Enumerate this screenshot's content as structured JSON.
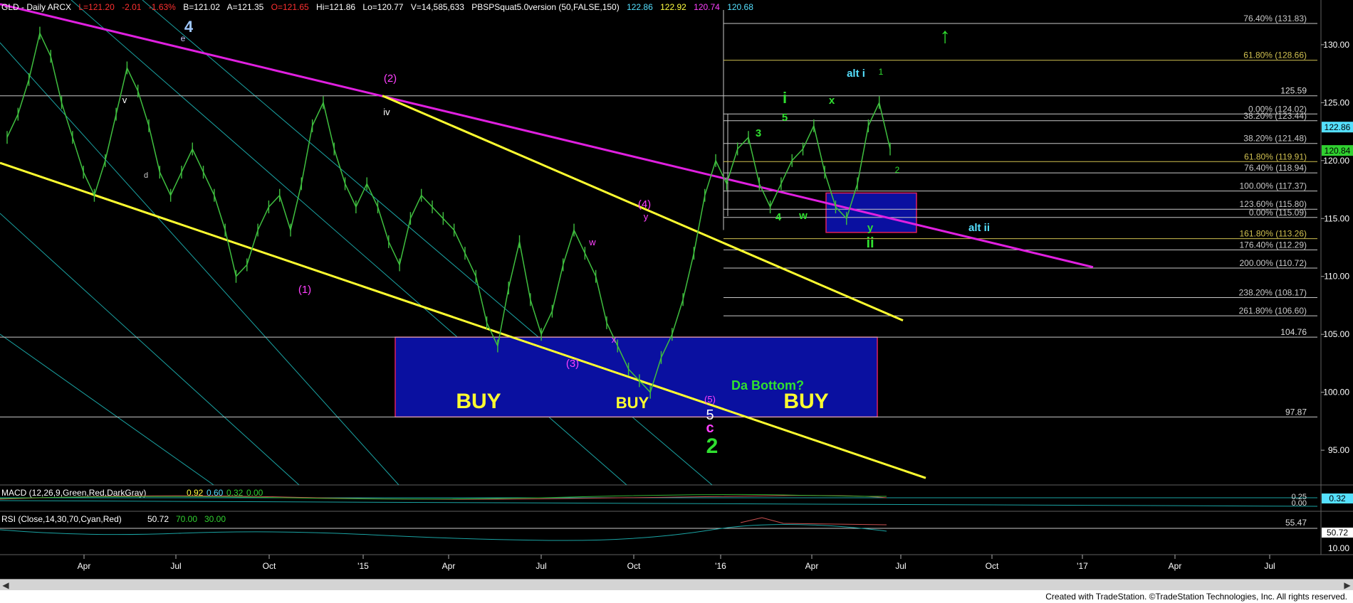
{
  "header": {
    "symbol": "GLD - Daily  ARCX",
    "last": "L=121.20",
    "change": "-2.01",
    "change_pct": "-1.63%",
    "bid": "B=121.02",
    "ask": "A=121.35",
    "open": "O=121.65",
    "high": "Hi=121.86",
    "low": "Lo=120.77",
    "volume": "V=14,585,633",
    "indicator": "PBSPSquat5.0version (50,FALSE,150)",
    "ind_vals": [
      "122.86",
      "122.92",
      "120.74",
      "120.68"
    ],
    "colors": {
      "label": "#ffffff",
      "red": "#ff3030",
      "cyan": "#55e0ff",
      "yellow": "#ffff40",
      "magenta": "#ff40ff"
    }
  },
  "footer": {
    "credit": "Created with TradeStation. ©TradeStation Technologies, Inc. All rights reserved."
  },
  "colors": {
    "background": "#000000",
    "candles": "#3fbf3f",
    "magenta_trend": "#e020e0",
    "yellow_trend": "#ffff30",
    "channel": "#1aa3a3",
    "buy_box": "#0a10a0",
    "box_border": "#e02060",
    "grid_lines": "#c8c8c8",
    "fib_lines": "#c8c8c8"
  },
  "chart_data": [
    {
      "type": "line",
      "title": "GLD - Daily ARCX",
      "ylim": [
        92,
        133
      ],
      "y_ticks": [
        "130.00",
        "125.00",
        "120.00",
        "115.00",
        "110.00",
        "105.00",
        "100.00",
        "95.00"
      ],
      "x_ticks": [
        "Apr",
        "Jul",
        "Oct",
        "'15",
        "Apr",
        "Jul",
        "Oct",
        "'16",
        "Apr",
        "Jul",
        "Oct",
        "'17",
        "Apr",
        "Jul"
      ],
      "last_price_tags": [
        {
          "value": "122.86",
          "color": "#55e0ff"
        },
        {
          "value": "120.84",
          "color": "#30d030"
        }
      ],
      "series": [
        {
          "values": [
            122,
            124,
            127,
            131,
            129,
            125,
            122,
            119,
            117,
            120,
            124,
            128,
            126,
            123,
            119,
            117,
            119,
            121,
            119,
            117,
            114,
            110,
            111,
            114,
            116,
            117,
            114,
            118,
            123,
            125,
            121,
            118,
            116,
            118,
            116,
            113,
            111,
            115,
            117,
            116,
            115,
            114,
            112,
            110,
            106,
            104,
            109,
            113,
            108,
            105,
            107,
            111,
            114,
            112,
            110,
            106,
            104,
            102,
            101,
            100,
            103,
            105,
            108,
            112,
            117,
            120,
            118,
            121,
            122,
            118,
            116,
            118,
            120,
            121,
            123,
            119,
            116,
            115,
            118,
            123,
            125,
            121
          ]
        }
      ],
      "horizontal_levels": [
        "125.59",
        "104.76",
        "97.87"
      ],
      "fib_levels": [
        {
          "label": "76.40% (131.83)",
          "value": 131.83
        },
        {
          "label": "61.80% (128.66)",
          "value": 128.66
        },
        {
          "label": "0.00% (124.02)",
          "value": 124.02
        },
        {
          "label": "38.20% (123.44)",
          "value": 123.44
        },
        {
          "label": "38.20% (121.48)",
          "value": 121.48
        },
        {
          "label": "61.80% (119.91)",
          "value": 119.91
        },
        {
          "label": "76.40% (118.94)",
          "value": 118.94
        },
        {
          "label": "100.00% (117.37)",
          "value": 117.37
        },
        {
          "label": "123.60% (115.80)",
          "value": 115.8
        },
        {
          "label": "0.00% (115.09)",
          "value": 115.09
        },
        {
          "label": "161.80% (113.26)",
          "value": 113.26
        },
        {
          "label": "176.40% (112.29)",
          "value": 112.29
        },
        {
          "label": "200.00% (110.72)",
          "value": 110.72
        },
        {
          "label": "238.20% (108.17)",
          "value": 108.17
        },
        {
          "label": "261.80% (106.60)",
          "value": 106.6
        }
      ],
      "wave_labels": [
        {
          "text": "4",
          "color": "#a0c8ff"
        },
        {
          "text": "e",
          "color": "#c8c8ff"
        },
        {
          "text": "v",
          "color": "#ffffff"
        },
        {
          "text": "d",
          "color": "#c8c8c8"
        },
        {
          "text": "(2)",
          "color": "#ff40ff"
        },
        {
          "text": "iv",
          "color": "#ffffff"
        },
        {
          "text": "(1)",
          "color": "#ff40ff"
        },
        {
          "text": "(4)",
          "color": "#ff40ff"
        },
        {
          "text": "y",
          "color": "#ff40ff"
        },
        {
          "text": "w",
          "color": "#ff40ff"
        },
        {
          "text": "x",
          "color": "#ff40ff"
        },
        {
          "text": "(3)",
          "color": "#ff40ff"
        },
        {
          "text": "(5)",
          "color": "#ff40ff"
        },
        {
          "text": "5",
          "color": "#ffffff"
        },
        {
          "text": "c",
          "color": "#ff40ff"
        },
        {
          "text": "2",
          "color": "#30e030"
        },
        {
          "text": "Da Bottom?",
          "color": "#30e030"
        },
        {
          "text": "BUY",
          "color": "#ffff30"
        },
        {
          "text": "BUY",
          "color": "#ffff30"
        },
        {
          "text": "BUY",
          "color": "#ffff30"
        },
        {
          "text": "3",
          "color": "#30e030"
        },
        {
          "text": "i",
          "color": "#30e030"
        },
        {
          "text": "5",
          "color": "#30e030"
        },
        {
          "text": "4",
          "color": "#30e030"
        },
        {
          "text": "w",
          "color": "#30e030"
        },
        {
          "text": "x",
          "color": "#30e030"
        },
        {
          "text": "y",
          "color": "#30e030"
        },
        {
          "text": "ii",
          "color": "#30e030"
        },
        {
          "text": "alt i",
          "color": "#55e0ff"
        },
        {
          "text": "alt ii",
          "color": "#55e0ff"
        },
        {
          "text": "1",
          "color": "#30e030"
        },
        {
          "text": "2",
          "color": "#30e030"
        },
        {
          "text": "↑",
          "color": "#30e030"
        }
      ]
    },
    {
      "type": "line",
      "title": "MACD (12,26,9,Green,Red,DarkGray)",
      "values_shown": [
        "0.92",
        "0.60",
        "0.32",
        "0.00"
      ],
      "y_tags": [
        "0.25",
        "0.00",
        "0.32"
      ]
    },
    {
      "type": "line",
      "title": "RSI (Close,14,30,70,Cyan,Red)",
      "values_shown": [
        "50.72",
        "70.00",
        "30.00"
      ],
      "y_tags": [
        "55.47",
        "50.72",
        "10.00"
      ]
    }
  ]
}
